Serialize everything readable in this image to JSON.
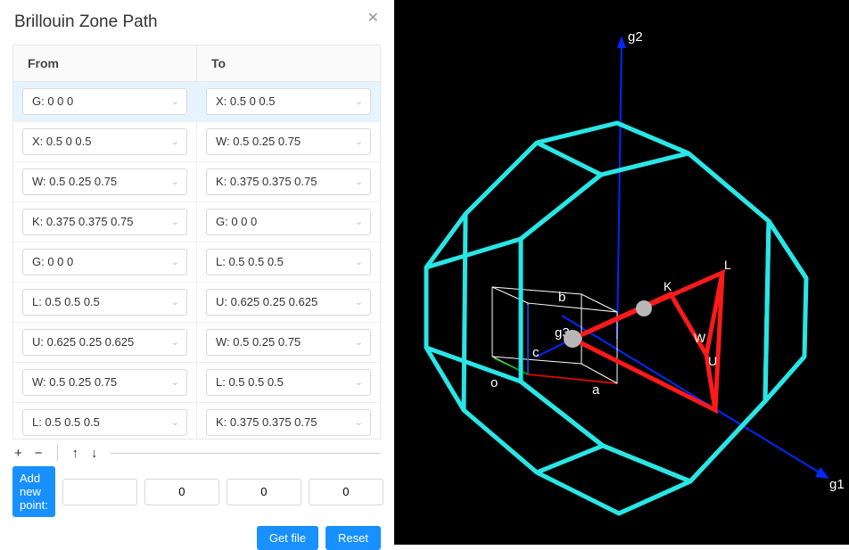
{
  "header": {
    "title": "Brillouin Zone Path"
  },
  "table": {
    "from_label": "From",
    "to_label": "To",
    "rows": [
      {
        "from": "G:  0 0 0",
        "to": "X:  0.5 0 0.5",
        "selected": true
      },
      {
        "from": "X:  0.5 0 0.5",
        "to": "W:  0.5 0.25 0.75",
        "selected": false
      },
      {
        "from": "W:  0.5 0.25 0.75",
        "to": "K:  0.375 0.375 0.75",
        "selected": false
      },
      {
        "from": "K:  0.375 0.375 0.75",
        "to": "G:  0 0 0",
        "selected": false
      },
      {
        "from": "G:  0 0 0",
        "to": "L:  0.5 0.5 0.5",
        "selected": false
      },
      {
        "from": "L:  0.5 0.5 0.5",
        "to": "U:  0.625 0.25 0.625",
        "selected": false
      },
      {
        "from": "U:  0.625 0.25 0.625",
        "to": "W:  0.5 0.25 0.75",
        "selected": false
      },
      {
        "from": "W:  0.5 0.25 0.75",
        "to": "L:  0.5 0.5 0.5",
        "selected": false
      },
      {
        "from": "L:  0.5 0.5 0.5",
        "to": "K:  0.375 0.375 0.75",
        "selected": false
      }
    ]
  },
  "toolbar": {
    "add_label": "+",
    "remove_label": "−",
    "up_label": "↑",
    "down_label": "↓"
  },
  "add_point": {
    "label": "Add new point:",
    "x": "0",
    "y": "0",
    "z": "0"
  },
  "footer": {
    "get_file": "Get file",
    "reset": "Reset"
  },
  "viewer": {
    "axes": {
      "g1": "g1",
      "g2": "g2",
      "g3": "g3",
      "a": "a",
      "b": "b",
      "c": "c",
      "origin": "o"
    },
    "points": {
      "L": "L",
      "K": "K",
      "W": "W",
      "U": "U"
    },
    "colors": {
      "bz_wire": "#29e6e6",
      "path": "#ff1a1a",
      "g1": "#0028ff",
      "g2": "#0028ff",
      "g3": "#0028ff",
      "a": "#ff0000",
      "b": "#00b400",
      "c": "#0060ff"
    }
  }
}
